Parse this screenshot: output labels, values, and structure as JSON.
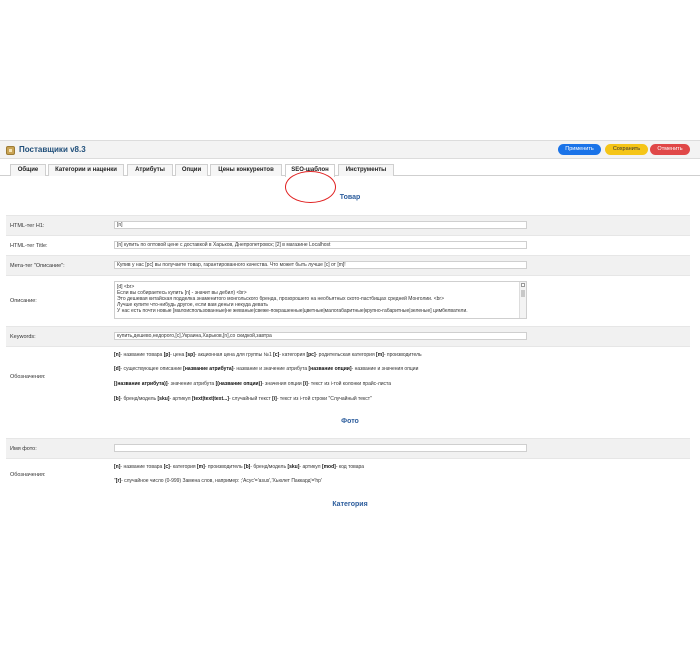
{
  "header": {
    "title": "Поставщики v8.3",
    "buttons": {
      "apply": "Применить",
      "save": "Сохранить",
      "cancel": "Отменить"
    },
    "colors": {
      "apply": "#1a73e8",
      "save": "#f5c518",
      "cancel": "#e04848"
    }
  },
  "tabs": [
    {
      "label": "Общие"
    },
    {
      "label": "Категории и наценки"
    },
    {
      "label": "Атрибуты"
    },
    {
      "label": "Опции"
    },
    {
      "label": "Цены конкурентов"
    },
    {
      "label": "SEO-шаблон"
    },
    {
      "label": "Инструменты"
    }
  ],
  "active_tab": "SEO-шаблон",
  "product": {
    "title": "Товар",
    "h1_label": "HTML-тег H1:",
    "h1_value": "[n]",
    "title_label": "HTML-тег Title:",
    "title_value": "[n] купить по оптовой цене с доставкой в Харьков, Днепропетровск; [2] в магазине Localhost",
    "meta_label": "Мета-тег \"Описание\":",
    "meta_value": "Купив у нас [pc] вы получаете товар, гарантированного качества. Что может быть лучше [c] от [m]!",
    "desc_label": "Описание:",
    "desc_lines": [
      "[d] <br>",
      "Если вы собираетесь купить [n] - значит вы дебил) <br>",
      "Это дешевая китайская подделка знаменитого монгольского бренда, прозорошего на необъятных ското-пастбищах средней Монголии. <br>",
      "Лучше купите что-нибудь другое, если вам деньги некуда девать",
      "У нас есть почти новые [малоиспользованные|не жеваные|свеже-покрашенные|цветные|малогабаритные|крупно-габаритные|зеленые] цимбелватели."
    ],
    "keywords_label": "Keywords:",
    "keywords_value": "купить,дешево,недорого,[c],Украина,Харьков,[n],со скидкой,завтра",
    "notation_label": "Обозначения:",
    "notation_lines": [
      [
        {
          "b": "[n]"
        },
        {
          "t": "- название товара "
        },
        {
          "b": "[p]"
        },
        {
          "t": "- цена "
        },
        {
          "b": "[sp]"
        },
        {
          "t": "- акционная цена для группы №1 "
        },
        {
          "b": "[c]"
        },
        {
          "t": "- категория "
        },
        {
          "b": "[pc]"
        },
        {
          "t": "- родительская категория "
        },
        {
          "b": "[m]"
        },
        {
          "t": "- производитель"
        }
      ],
      [
        {
          "b": "[d]"
        },
        {
          "t": "- существующее описание "
        },
        {
          "b": "[название атрибута]"
        },
        {
          "t": "- название и значение атрибута "
        },
        {
          "b": "[название опции]"
        },
        {
          "t": "- название и значения опции"
        }
      ],
      [
        {
          "b": "[(название атрибута)]"
        },
        {
          "t": "- значение атрибута "
        },
        {
          "b": "[(название опции)]"
        },
        {
          "t": "- значения опции "
        },
        {
          "b": "[i]"
        },
        {
          "t": "- текст из i-той колонки прайс-листа"
        }
      ],
      [
        {
          "b": "[b]"
        },
        {
          "t": "- бренд/модель "
        },
        {
          "b": "[sku]"
        },
        {
          "t": "- артикул "
        },
        {
          "b": "[text|text|text...]"
        },
        {
          "t": "- случайный текст "
        },
        {
          "b": "[i]"
        },
        {
          "t": "- текст из i-той строки \"Случайный текст\""
        }
      ]
    ]
  },
  "photo": {
    "title": "Фото",
    "name_label": "Имя фото:",
    "name_value": "",
    "notation_label": "Обозначения:",
    "notation_lines": [
      [
        {
          "b": "[n]"
        },
        {
          "t": "- название товара "
        },
        {
          "b": "[c]"
        },
        {
          "t": "- категория "
        },
        {
          "b": "[m]"
        },
        {
          "t": "- производитель "
        },
        {
          "b": "[b]"
        },
        {
          "t": "- бренд/модель "
        },
        {
          "b": "[sku]"
        },
        {
          "t": "- артикул "
        },
        {
          "b": "[mod]"
        },
        {
          "t": "- код товара"
        }
      ],
      [
        {
          "t": "\""
        },
        {
          "b": "[r]"
        },
        {
          "t": "- случайное число (0-999)      Замена слов, например:  ;'Асус'='asus','Хьюлет Паккард'='hp'"
        }
      ]
    ]
  },
  "category": {
    "title": "Категория"
  }
}
